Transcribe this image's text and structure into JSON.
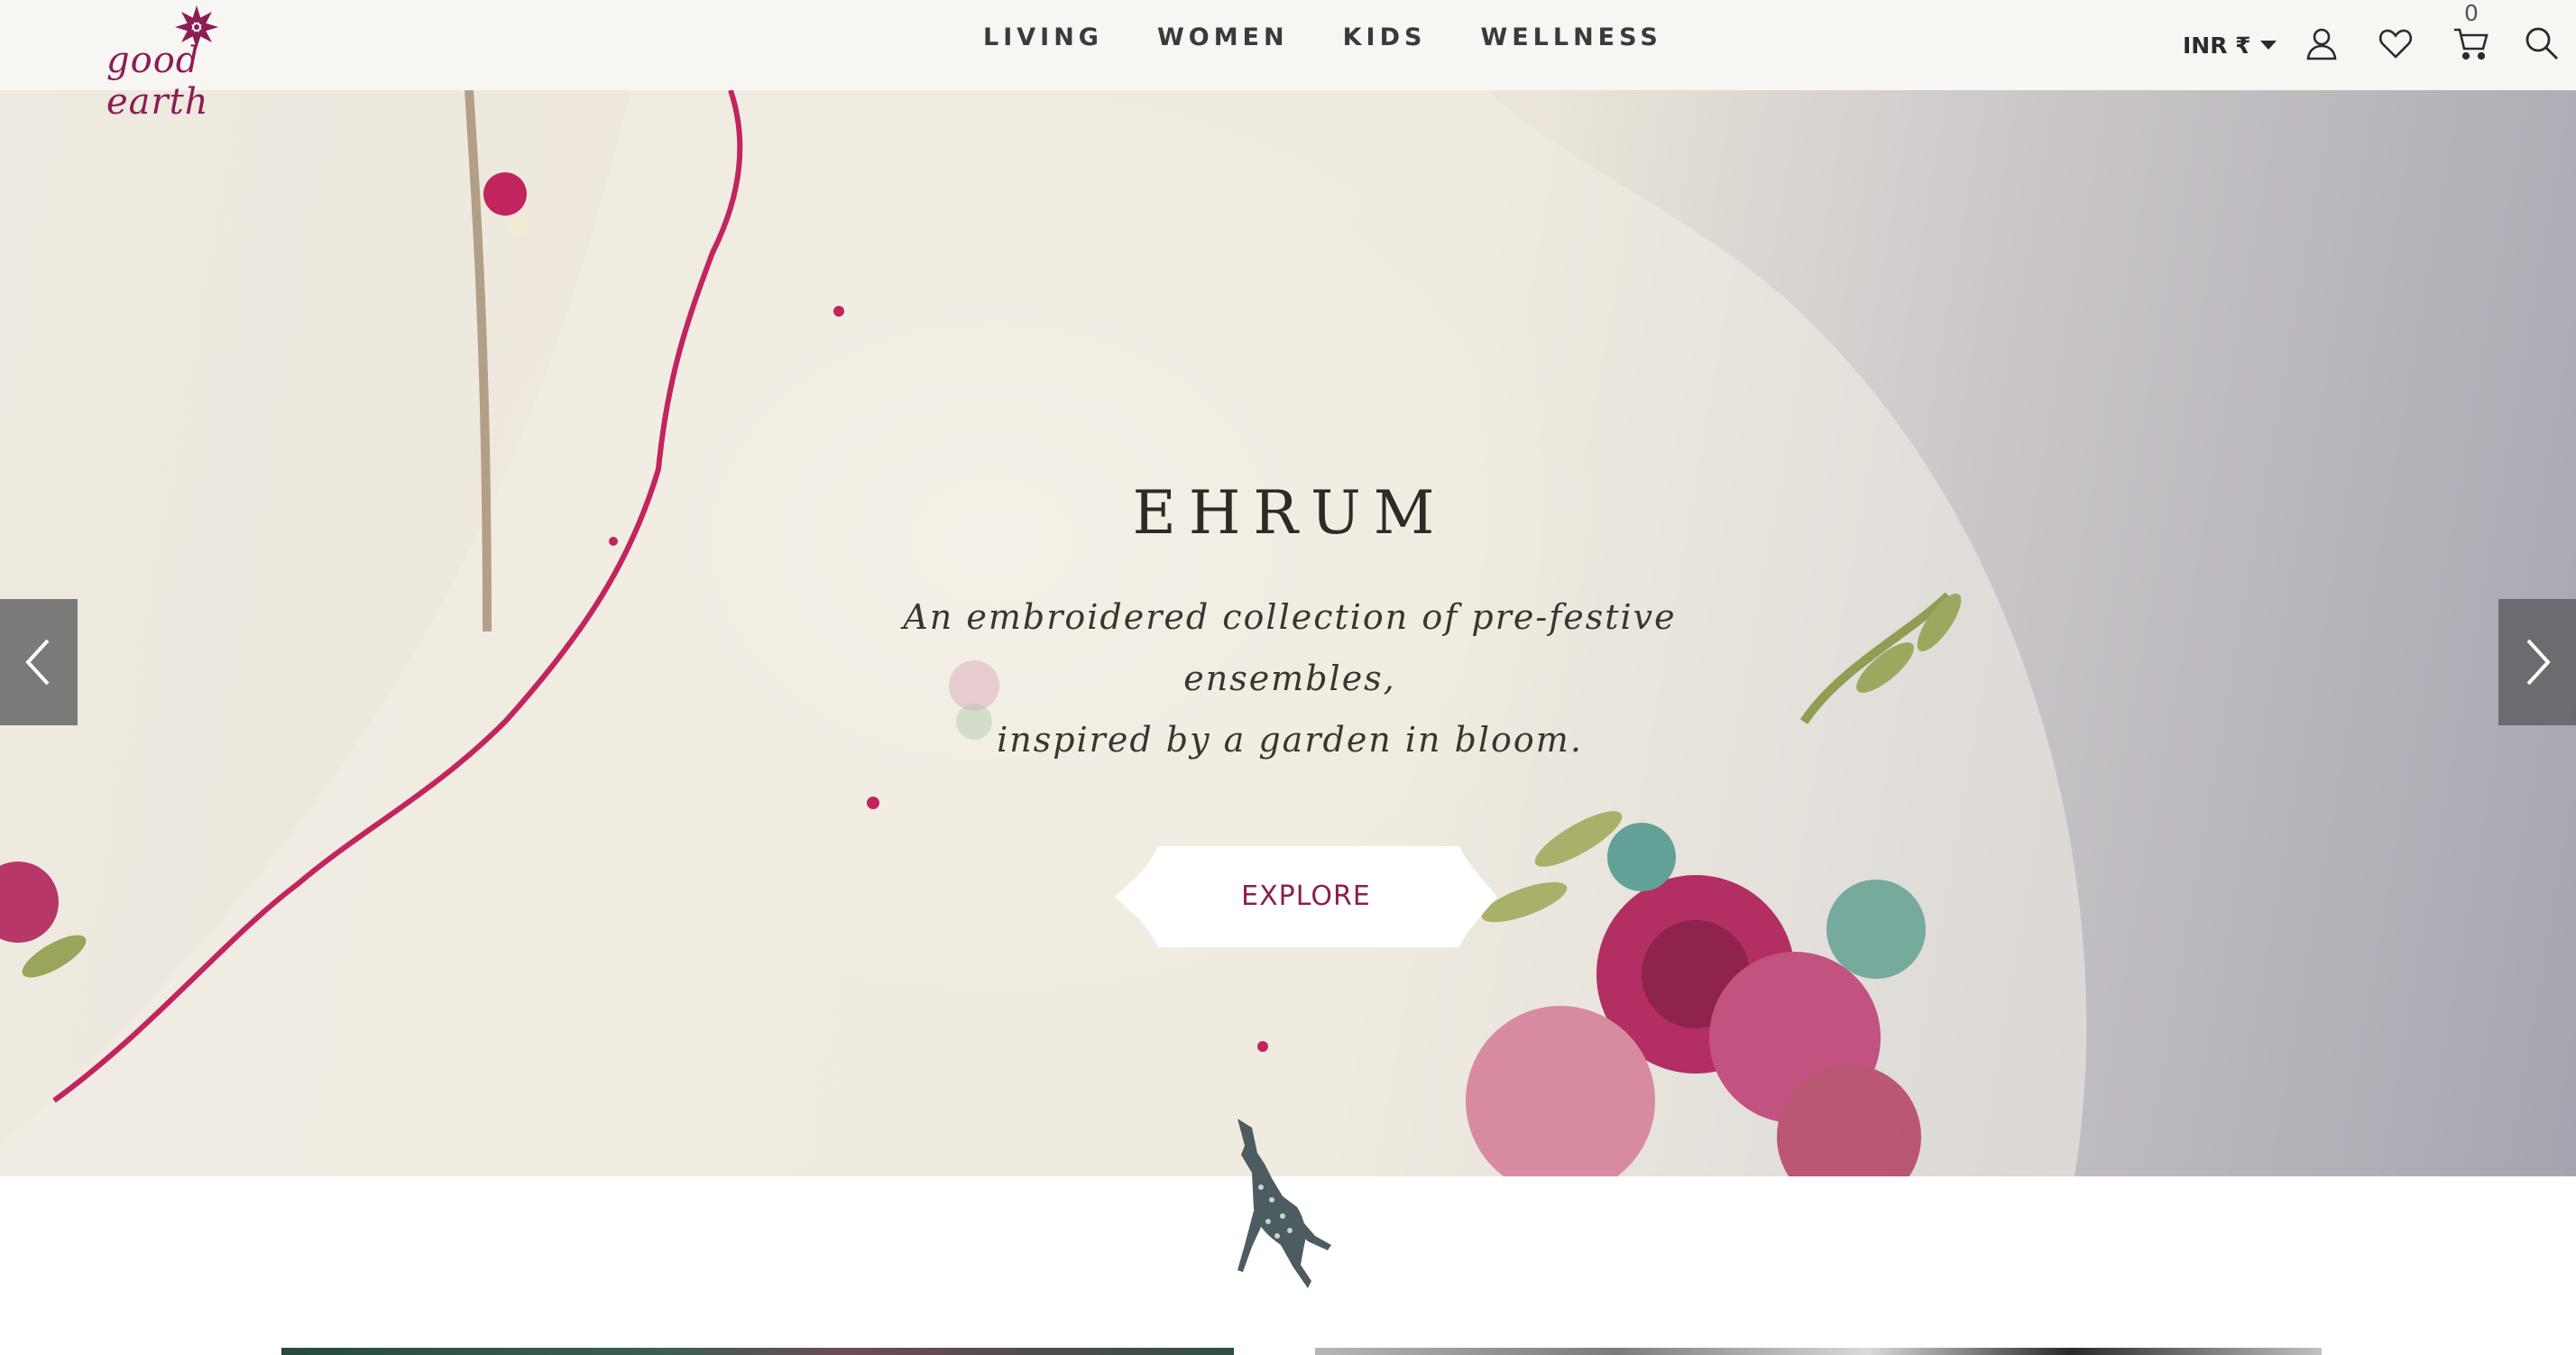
{
  "header": {
    "logo_text": "good earth",
    "nav": [
      "LIVING",
      "WOMEN",
      "KIDS",
      "WELLNESS"
    ],
    "currency": "INR ₹",
    "cart_count": "0",
    "icons": [
      "user-icon",
      "heart-icon",
      "cart-icon",
      "search-icon"
    ]
  },
  "hero": {
    "title": "EHRUM",
    "subtitle_line1": "An embroidered collection of pre-festive ensembles,",
    "subtitle_line2": "inspired by a garden in bloom.",
    "cta_label": "EXPLORE",
    "prev_icon": "chevron-left-icon",
    "next_icon": "chevron-right-icon"
  },
  "colors": {
    "brand": "#8c1d55",
    "header_bg": "#f8f6f3",
    "text_dark": "#2e2a26"
  }
}
